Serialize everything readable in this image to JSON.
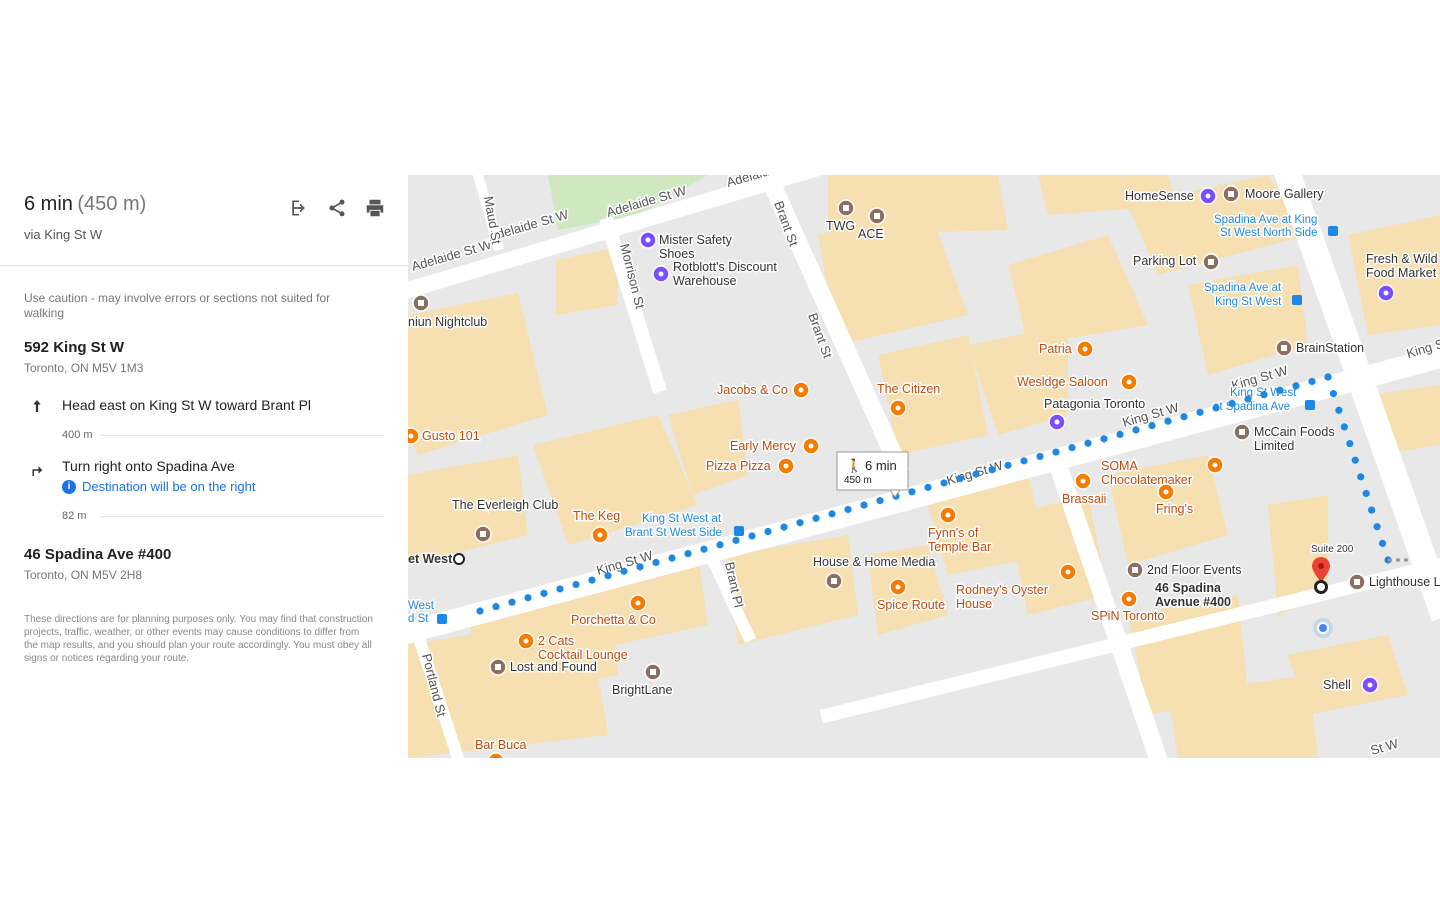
{
  "summary": {
    "duration": "6 min",
    "distance": "(450 m)",
    "via": "via King St W"
  },
  "tools": {
    "open_icon": "exit-to-app-icon",
    "share_icon": "share-icon",
    "print_icon": "print-icon"
  },
  "caution": "Use caution - may involve errors or sections not suited for walking",
  "origin": {
    "address": "592 King St W",
    "city": "Toronto, ON M5V 1M3"
  },
  "steps": [
    {
      "icon": "arrow-up-icon",
      "text": "Head east on King St W toward Brant Pl",
      "distance": "400 m"
    },
    {
      "icon": "turn-right-icon",
      "text": "Turn right onto Spadina Ave",
      "note": "Destination will be on the right",
      "distance": "82 m"
    }
  ],
  "destination": {
    "address": "46 Spadina Ave #400",
    "city": "Toronto, ON M5V 2H8"
  },
  "disclaimer": "These directions are for planning purposes only. You may find that construction projects, traffic, weather, or other events may cause conditions to differ from the map results, and you should plan your route accordingly. You must obey all signs or notices regarding your route.",
  "map": {
    "colors": {
      "route": "#1e88e5",
      "restaurant": "#f57c00",
      "shop": "#7c4dff",
      "generic": "#8d6e63",
      "transit": "#1e88e5",
      "building": "#f6dfb0",
      "road": "#ffffff",
      "ground": "#e8e8e8",
      "park": "#cfe8c0"
    },
    "route_callout": {
      "time": "6 min",
      "distance": "450 m"
    },
    "street_labels": [
      "Adelaide St W",
      "Adelaide St W",
      "Adelaide St W",
      "Adelaide S",
      "Maud St",
      "Morrison St",
      "Brant St",
      "Brant St",
      "Brant Pl",
      "Portland St",
      "King St W",
      "King St W",
      "King St W",
      "King St W",
      "King S",
      "St W"
    ],
    "transit_labels": [
      "King St West at Brant St West Side",
      "Spadina Ave at King St West North Side",
      "Spadina Ave at King St West",
      "King St West at Spadina Ave",
      "West d St"
    ],
    "pois": [
      {
        "name": "TWG",
        "type": "generic"
      },
      {
        "name": "ACE",
        "type": "generic"
      },
      {
        "name": "HomeSense",
        "type": "shop"
      },
      {
        "name": "Moore Gallery",
        "type": "generic"
      },
      {
        "name": "Fresh & Wild Food Market",
        "type": "shop"
      },
      {
        "name": "Mister Safety Shoes",
        "type": "shop"
      },
      {
        "name": "Rotblott's Discount Warehouse",
        "type": "shop"
      },
      {
        "name": "Parking Lot",
        "type": "generic"
      },
      {
        "name": "niun Nightclub",
        "type": "generic"
      },
      {
        "name": "BrainStation",
        "type": "generic"
      },
      {
        "name": "Patria",
        "type": "restaurant"
      },
      {
        "name": "Jacobs & Co",
        "type": "restaurant"
      },
      {
        "name": "The Citizen",
        "type": "restaurant"
      },
      {
        "name": "Wesldge Saloon",
        "type": "restaurant"
      },
      {
        "name": "Patagonia Toronto",
        "type": "shop"
      },
      {
        "name": "Gusto 101",
        "type": "restaurant"
      },
      {
        "name": "McCain Foods Limited",
        "type": "generic"
      },
      {
        "name": "Early Mercy",
        "type": "restaurant"
      },
      {
        "name": "Pizza Pizza",
        "type": "restaurant"
      },
      {
        "name": "SOMA Chocolatemaker",
        "type": "restaurant"
      },
      {
        "name": "Brassaii",
        "type": "restaurant"
      },
      {
        "name": "Fring's",
        "type": "restaurant"
      },
      {
        "name": "The Everleigh Club",
        "type": "generic"
      },
      {
        "name": "The Keg",
        "type": "restaurant"
      },
      {
        "name": "Fynn's of Temple Bar",
        "type": "restaurant"
      },
      {
        "name": "House & Home Media",
        "type": "generic"
      },
      {
        "name": "2nd Floor Events",
        "type": "generic"
      },
      {
        "name": "Suite 200",
        "type": "label"
      },
      {
        "name": "Lighthouse L",
        "type": "generic"
      },
      {
        "name": "46 Spadina Avenue #400",
        "type": "destination"
      },
      {
        "name": "et West",
        "type": "origin"
      },
      {
        "name": "Porchetta & Co",
        "type": "restaurant"
      },
      {
        "name": "Spice Route",
        "type": "restaurant"
      },
      {
        "name": "Rodney's Oyster House",
        "type": "restaurant"
      },
      {
        "name": "SPiN Toronto",
        "type": "restaurant"
      },
      {
        "name": "2 Cats Cocktail Lounge",
        "type": "restaurant"
      },
      {
        "name": "Lost and Found",
        "type": "generic"
      },
      {
        "name": "BrightLane",
        "type": "generic"
      },
      {
        "name": "Shell",
        "type": "shop"
      },
      {
        "name": "Bar Buca",
        "type": "restaurant"
      }
    ]
  }
}
